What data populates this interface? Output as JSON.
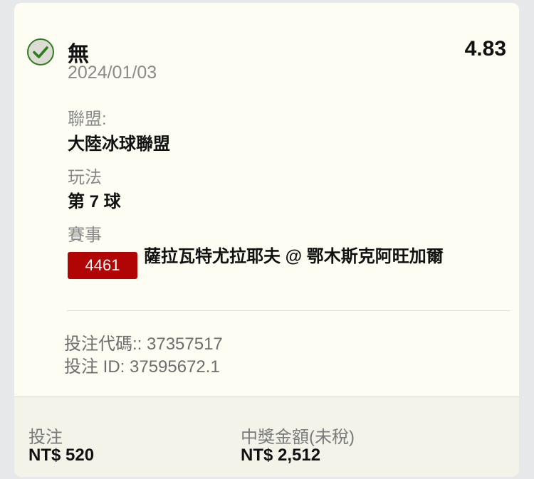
{
  "bet": {
    "selection": "無",
    "odds": "4.83",
    "date": "2024/01/03",
    "status_icon": "check-circle-icon",
    "status_color": "#2e7d1f"
  },
  "fields": {
    "league_label": "聯盟:",
    "league_value": "大陸冰球聯盟",
    "market_label": "玩法",
    "market_value": "第 7 球",
    "event_label": "賽事"
  },
  "event": {
    "id": "4461",
    "badge_color": "#b10404",
    "name": "薩拉瓦特尤拉耶夫 @ 鄂木斯克阿旺加爾"
  },
  "codes": {
    "bet_code": "投注代碼:: 37357517",
    "bet_id": "投注 ID: 37595672.1"
  },
  "footer": {
    "stake_label": "投注",
    "stake_value": "NT$ 520",
    "payout_label": "中獎金額(未稅)",
    "payout_value": "NT$ 2,512"
  }
}
